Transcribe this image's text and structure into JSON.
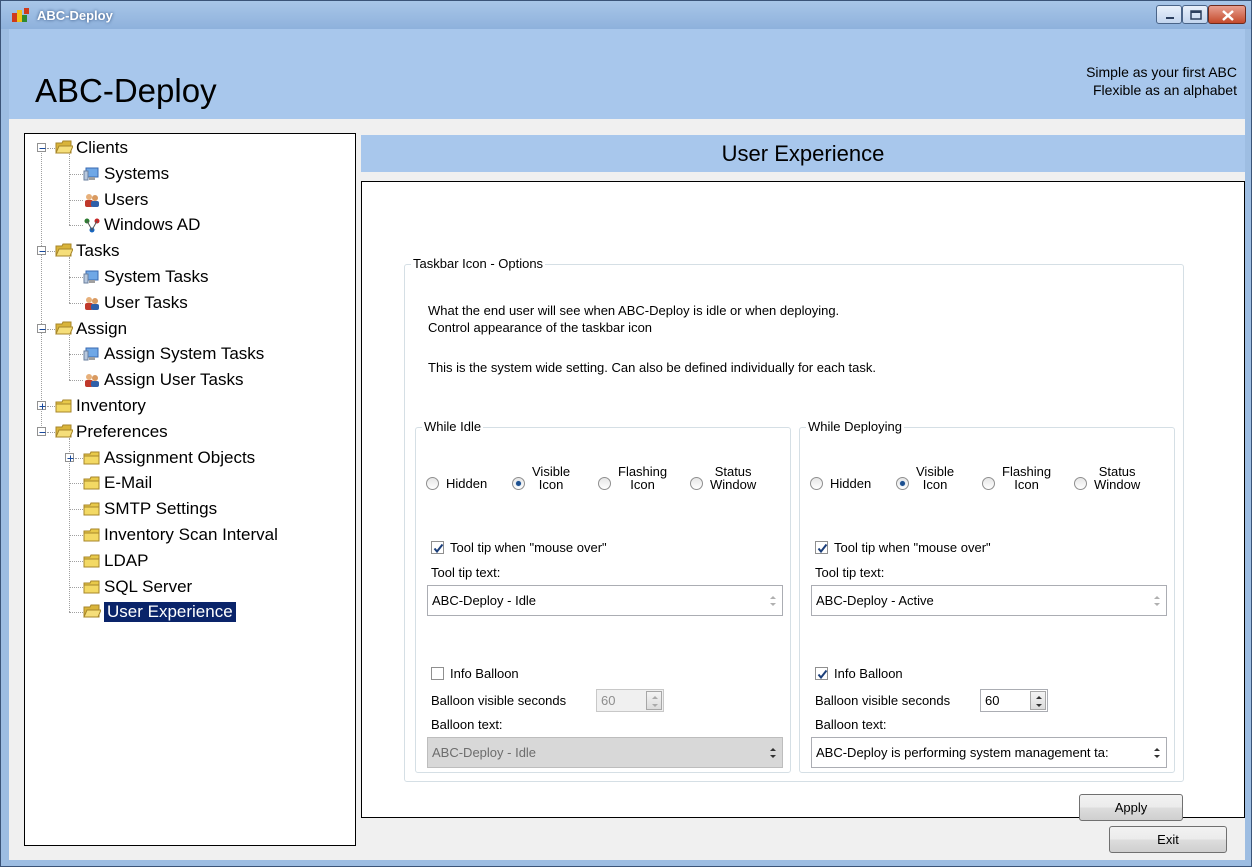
{
  "window": {
    "title": "ABC-Deploy"
  },
  "header": {
    "app_title": "ABC-Deploy",
    "tagline_line1": "Simple as your first ABC",
    "tagline_line2": "Flexible as an alphabet"
  },
  "tree": {
    "items": [
      {
        "label": "Clients"
      },
      {
        "label": "Systems"
      },
      {
        "label": "Users"
      },
      {
        "label": "Windows AD"
      },
      {
        "label": "Tasks"
      },
      {
        "label": "System Tasks"
      },
      {
        "label": "User Tasks"
      },
      {
        "label": "Assign"
      },
      {
        "label": "Assign System Tasks"
      },
      {
        "label": "Assign User Tasks"
      },
      {
        "label": "Inventory"
      },
      {
        "label": "Preferences"
      },
      {
        "label": "Assignment Objects"
      },
      {
        "label": "E-Mail"
      },
      {
        "label": "SMTP Settings"
      },
      {
        "label": "Inventory Scan Interval"
      },
      {
        "label": "LDAP"
      },
      {
        "label": "SQL Server"
      },
      {
        "label": "User Experience",
        "selected": true
      }
    ]
  },
  "page": {
    "title": "User Experience"
  },
  "taskbar_group": {
    "caption": "Taskbar Icon - Options",
    "desc_line1": "What the end user will see when ABC-Deploy is idle or when deploying.",
    "desc_line2": "Control appearance of the taskbar icon",
    "desc_line3": "This is the system wide setting. Can also be defined individually for each task."
  },
  "idle": {
    "caption": "While Idle",
    "radio_hidden": "Hidden",
    "radio_visible_1": "Visible",
    "radio_visible_2": "Icon",
    "radio_flashing_1": "Flashing",
    "radio_flashing_2": "Icon",
    "radio_status_1": "Status",
    "radio_status_2": "Window",
    "selected_mode": "Visible Icon",
    "tooltip_checkbox": "Tool tip when \"mouse over\"",
    "tooltip_checked": true,
    "tooltip_text_label": "Tool tip text:",
    "tooltip_text_value": "ABC-Deploy - Idle",
    "balloon_checkbox": "Info Balloon",
    "balloon_checked": false,
    "balloon_seconds_label": "Balloon visible seconds",
    "balloon_seconds_value": "60",
    "balloon_text_label": "Balloon text:",
    "balloon_text_value": "ABC-Deploy - Idle"
  },
  "deploying": {
    "caption": "While Deploying",
    "radio_hidden": "Hidden",
    "radio_visible_1": "Visible",
    "radio_visible_2": "Icon",
    "radio_flashing_1": "Flashing",
    "radio_flashing_2": "Icon",
    "radio_status_1": "Status",
    "radio_status_2": "Window",
    "selected_mode": "Visible Icon",
    "tooltip_checkbox": "Tool tip when \"mouse over\"",
    "tooltip_checked": true,
    "tooltip_text_label": "Tool tip text:",
    "tooltip_text_value": "ABC-Deploy - Active",
    "balloon_checkbox": "Info Balloon",
    "balloon_checked": true,
    "balloon_seconds_label": "Balloon visible seconds",
    "balloon_seconds_value": "60",
    "balloon_text_label": "Balloon text:",
    "balloon_text_value": "ABC-Deploy is performing system management ta:"
  },
  "buttons": {
    "apply": "Apply",
    "exit": "Exit"
  },
  "colors": {
    "header_bg": "#a8c7ec",
    "selection_bg": "#0a246a"
  }
}
